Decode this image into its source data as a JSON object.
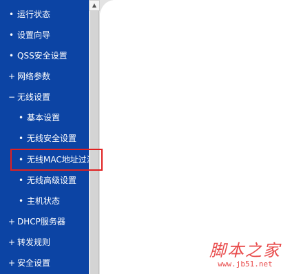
{
  "sidebar": {
    "items": [
      {
        "label": "运行状态",
        "bullet": "•",
        "level": 1
      },
      {
        "label": "设置向导",
        "bullet": "•",
        "level": 1
      },
      {
        "label": "QSS安全设置",
        "bullet": "•",
        "level": 1
      },
      {
        "label": "网络参数",
        "bullet": "+",
        "level": 1
      },
      {
        "label": "无线设置",
        "bullet": "−",
        "level": 1
      },
      {
        "label": "基本设置",
        "bullet": "•",
        "level": 2
      },
      {
        "label": "无线安全设置",
        "bullet": "•",
        "level": 2
      },
      {
        "label": "无线MAC地址过滤",
        "bullet": "•",
        "level": 2
      },
      {
        "label": "无线高级设置",
        "bullet": "•",
        "level": 2
      },
      {
        "label": "主机状态",
        "bullet": "•",
        "level": 2
      },
      {
        "label": "DHCP服务器",
        "bullet": "+",
        "level": 1
      },
      {
        "label": "转发规则",
        "bullet": "+",
        "level": 1
      },
      {
        "label": "安全设置",
        "bullet": "+",
        "level": 1
      }
    ],
    "highlighted_item": "无线MAC地址过滤"
  },
  "watermark": {
    "title": "脚本之家",
    "url": "www.jb51.net"
  },
  "colors": {
    "sidebar_bg": "#0c44a4",
    "highlight": "#e02020",
    "watermark": "#e84a4a"
  }
}
